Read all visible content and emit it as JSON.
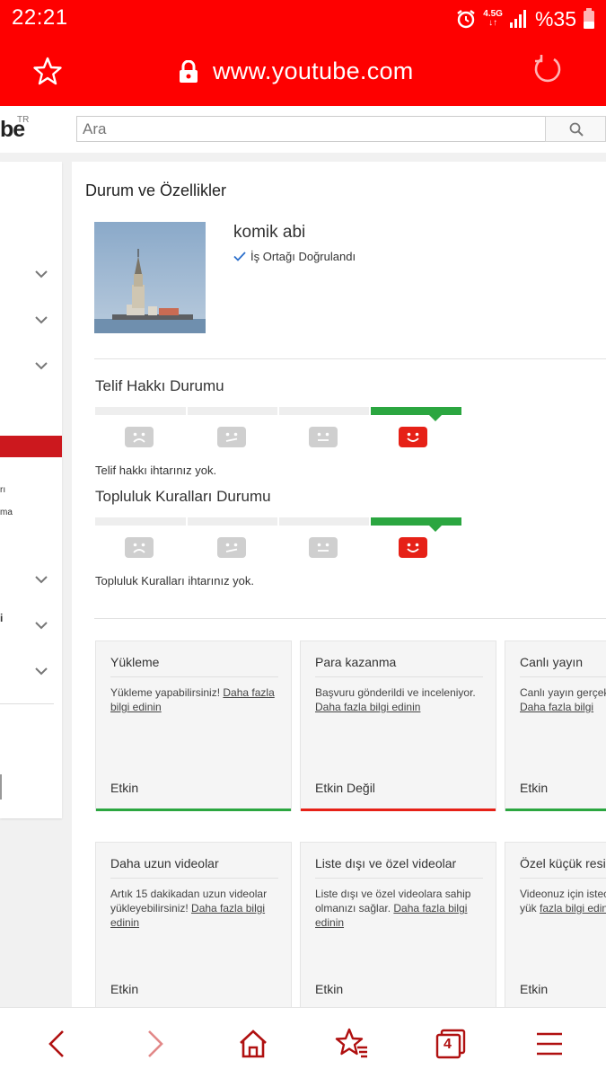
{
  "status_bar": {
    "time": "22:21",
    "network_type": "4.5G",
    "battery": "%35",
    "icons": [
      "alarm-icon",
      "signal-icon",
      "battery-icon"
    ]
  },
  "browser": {
    "url": "www.youtube.com",
    "icons": [
      "star-icon",
      "lock-icon",
      "reload-icon"
    ],
    "nav_icons": [
      "back-icon",
      "forward-icon",
      "home-icon",
      "bookmarks-icon",
      "tabs-icon",
      "menu-icon"
    ],
    "tab_count": "4"
  },
  "masthead": {
    "logo_text": "be",
    "logo_region": "TR",
    "search_placeholder": "Ara"
  },
  "sidebar": {
    "fragments": [
      "rı",
      "ma",
      "i"
    ]
  },
  "main": {
    "title": "Durum ve Özellikler",
    "channel": {
      "name": "komik abi",
      "verified_label": "İş Ortağı Doğrulandı"
    },
    "copyright": {
      "title": "Telif Hakkı Durumu",
      "note": "Telif hakkı ihtarınız yok.",
      "level": 4,
      "levels": 4
    },
    "community": {
      "title": "Topluluk Kuralları Durumu",
      "note": "Topluluk Kuralları ihtarınız yok.",
      "level": 4,
      "levels": 4
    },
    "cards": [
      {
        "title": "Yükleme",
        "desc": "Yükleme yapabilirsiniz! ",
        "link": "Daha fazla bilgi edinin",
        "status": "Etkin",
        "status_color": "#2ba640"
      },
      {
        "title": "Para kazanma",
        "desc": "Başvuru gönderildi ve inceleniyor. ",
        "link": "Daha fazla bilgi edinin",
        "status": "Etkin Değil",
        "status_color": "#e62117"
      },
      {
        "title": "Canlı yayın",
        "desc": "Canlı yayın gerçek",
        "link": "Daha fazla bilgi",
        "status": "Etkin",
        "status_color": "#2ba640"
      },
      {
        "title": "Daha uzun videolar",
        "desc": "Artık 15 dakikadan uzun videolar yükleyebilirsiniz! ",
        "link": "Daha fazla bilgi edinin",
        "status": "Etkin",
        "status_color": "#2ba640"
      },
      {
        "title": "Liste dışı ve özel videolar",
        "desc": "Liste dışı ve özel videolara sahip olmanızı sağlar. ",
        "link": "Daha fazla bilgi edinin",
        "status": "Etkin",
        "status_color": "#2ba640"
      },
      {
        "title": "Özel küçük resi",
        "desc": "Videonuz için istec resmi kendiniz yük ",
        "link": "fazla bilgi edinin",
        "status": "Etkin",
        "status_color": "#2ba640"
      }
    ]
  },
  "colors": {
    "brand_red": "#fe0000",
    "youtube_red": "#e62117",
    "green": "#2ba640"
  }
}
